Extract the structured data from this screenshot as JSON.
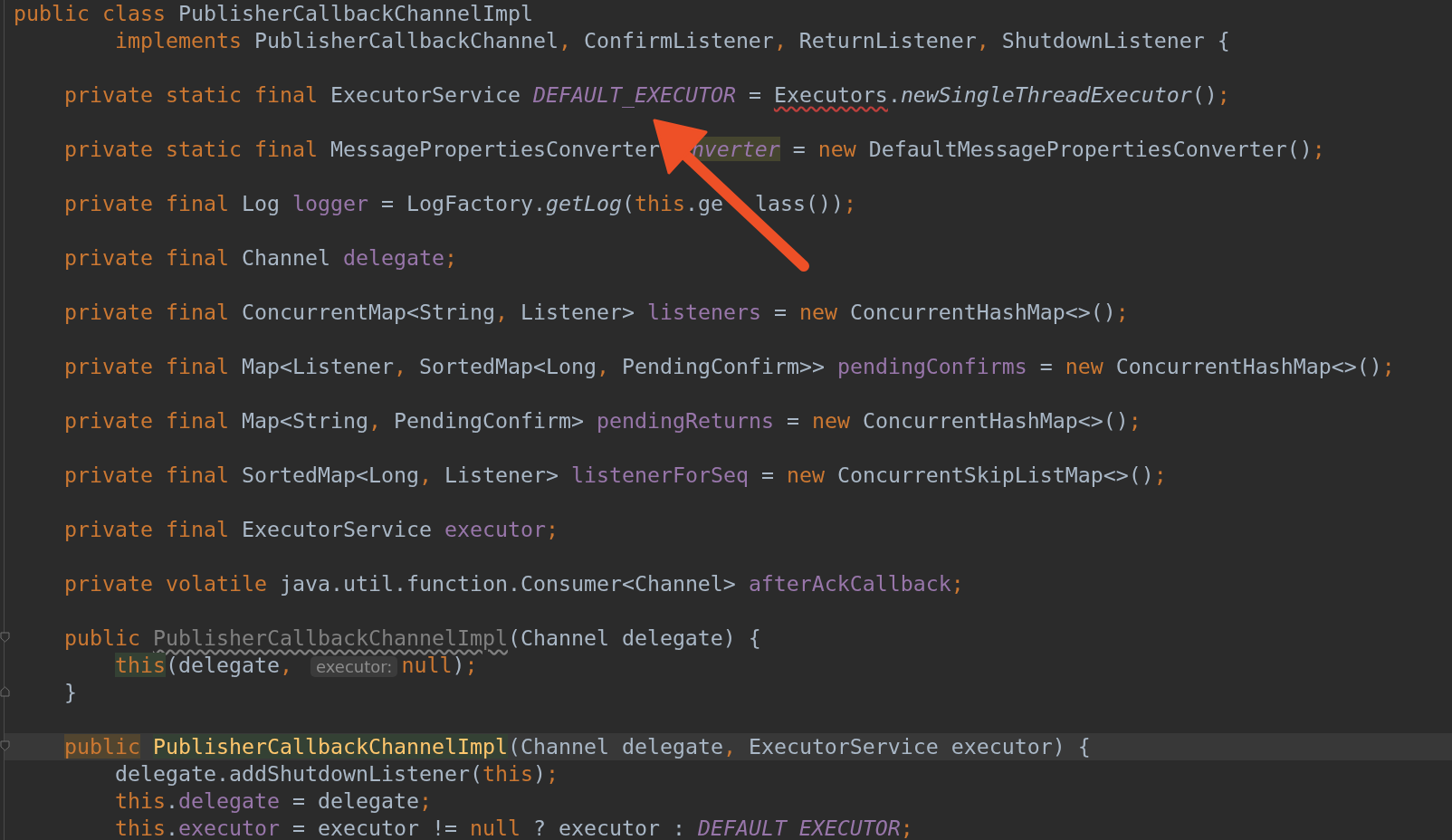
{
  "editor": {
    "lines": [
      {
        "kind": "top",
        "current": false,
        "tokens": [
          {
            "kind": "keyword",
            "text": "public class"
          },
          {
            "kind": "plain",
            "text": " PublisherCallbackChannelImpl"
          }
        ]
      },
      {
        "kind": "body",
        "current": false,
        "tokens": [
          {
            "kind": "keyword",
            "text": "implements"
          },
          {
            "kind": "plain",
            "text": " PublisherCallbackChannel"
          },
          {
            "kind": "keyword",
            "text": ","
          },
          {
            "kind": "plain",
            "text": " ConfirmListener"
          },
          {
            "kind": "keyword",
            "text": ","
          },
          {
            "kind": "plain",
            "text": " ReturnListener"
          },
          {
            "kind": "keyword",
            "text": ","
          },
          {
            "kind": "plain",
            "text": " ShutdownListener {"
          }
        ]
      },
      {
        "kind": "blank"
      },
      {
        "kind": "member",
        "current": false,
        "tokens": [
          {
            "kind": "keyword",
            "text": "private static final"
          },
          {
            "kind": "plain",
            "text": " ExecutorService "
          },
          {
            "kind": "static",
            "text": "DEFAULT_EXECUTOR"
          },
          {
            "kind": "plain",
            "text": " = "
          },
          {
            "kind": "warning",
            "text": "Executors"
          },
          {
            "kind": "plain",
            "text": "."
          },
          {
            "kind": "call",
            "text": "newSingleThreadExecutor"
          },
          {
            "kind": "plain",
            "text": "()"
          },
          {
            "kind": "keyword",
            "text": ";"
          }
        ]
      },
      {
        "kind": "blank"
      },
      {
        "kind": "member",
        "current": false,
        "tokens": [
          {
            "kind": "keyword",
            "text": "private static final"
          },
          {
            "kind": "plain",
            "text": " MessagePropertiesConverter"
          },
          {
            "kind": "covered"
          },
          {
            "kind": "static",
            "text": "nverter",
            "highlighted": true,
            "color": "#45452f"
          },
          {
            "kind": "plain",
            "text": " = "
          },
          {
            "kind": "keyword",
            "text": "new"
          },
          {
            "kind": "plain",
            "text": " DefaultMessagePropertiesConverter()"
          },
          {
            "kind": "keyword",
            "text": ";"
          }
        ]
      },
      {
        "kind": "blank"
      },
      {
        "kind": "member",
        "current": false,
        "tokens": [
          {
            "kind": "keyword",
            "text": "private final"
          },
          {
            "kind": "plain",
            "text": " Log "
          },
          {
            "kind": "field",
            "text": "logger"
          },
          {
            "kind": "plain",
            "text": " = LogFactory."
          },
          {
            "kind": "call",
            "text": "getLog"
          },
          {
            "kind": "plain",
            "text": "("
          },
          {
            "kind": "keyword",
            "text": "this"
          },
          {
            "kind": "plain",
            "text": ".ge"
          },
          {
            "kind": "covered"
          },
          {
            "kind": "plain",
            "text": "lass())"
          },
          {
            "kind": "keyword",
            "text": ";"
          }
        ]
      },
      {
        "kind": "blank"
      },
      {
        "kind": "member",
        "current": false,
        "tokens": [
          {
            "kind": "keyword",
            "text": "private final"
          },
          {
            "kind": "plain",
            "text": " Channel "
          },
          {
            "kind": "field",
            "text": "delegate"
          },
          {
            "kind": "keyword",
            "text": ";"
          }
        ]
      },
      {
        "kind": "blank"
      },
      {
        "kind": "member",
        "current": false,
        "tokens": [
          {
            "kind": "keyword",
            "text": "private final"
          },
          {
            "kind": "plain",
            "text": " ConcurrentMap<String"
          },
          {
            "kind": "keyword",
            "text": ","
          },
          {
            "kind": "plain",
            "text": " Listener> "
          },
          {
            "kind": "field",
            "text": "listeners"
          },
          {
            "kind": "plain",
            "text": " = "
          },
          {
            "kind": "keyword",
            "text": "new"
          },
          {
            "kind": "plain",
            "text": " ConcurrentHashMap<>()"
          },
          {
            "kind": "keyword",
            "text": ";"
          }
        ]
      },
      {
        "kind": "blank"
      },
      {
        "kind": "member",
        "current": false,
        "tokens": [
          {
            "kind": "keyword",
            "text": "private final"
          },
          {
            "kind": "plain",
            "text": " Map<Listener"
          },
          {
            "kind": "keyword",
            "text": ","
          },
          {
            "kind": "plain",
            "text": " SortedMap<Long"
          },
          {
            "kind": "keyword",
            "text": ","
          },
          {
            "kind": "plain",
            "text": " PendingConfirm>> "
          },
          {
            "kind": "field",
            "text": "pendingConfirms"
          },
          {
            "kind": "plain",
            "text": " = "
          },
          {
            "kind": "keyword",
            "text": "new"
          },
          {
            "kind": "plain",
            "text": " ConcurrentHashMap<>()"
          },
          {
            "kind": "keyword",
            "text": ";"
          }
        ]
      },
      {
        "kind": "blank"
      },
      {
        "kind": "member",
        "current": false,
        "tokens": [
          {
            "kind": "keyword",
            "text": "private final"
          },
          {
            "kind": "plain",
            "text": " Map<String"
          },
          {
            "kind": "keyword",
            "text": ","
          },
          {
            "kind": "plain",
            "text": " PendingConfirm> "
          },
          {
            "kind": "field",
            "text": "pendingReturns"
          },
          {
            "kind": "plain",
            "text": " = "
          },
          {
            "kind": "keyword",
            "text": "new"
          },
          {
            "kind": "plain",
            "text": " ConcurrentHashMap<>()"
          },
          {
            "kind": "keyword",
            "text": ";"
          }
        ]
      },
      {
        "kind": "blank"
      },
      {
        "kind": "member",
        "current": false,
        "tokens": [
          {
            "kind": "keyword",
            "text": "private final"
          },
          {
            "kind": "plain",
            "text": " SortedMap<Long"
          },
          {
            "kind": "keyword",
            "text": ","
          },
          {
            "kind": "plain",
            "text": " Listener> "
          },
          {
            "kind": "field",
            "text": "listenerForSeq"
          },
          {
            "kind": "plain",
            "text": " = "
          },
          {
            "kind": "keyword",
            "text": "new"
          },
          {
            "kind": "plain",
            "text": " ConcurrentSkipListMap<>()"
          },
          {
            "kind": "keyword",
            "text": ";"
          }
        ]
      },
      {
        "kind": "blank"
      },
      {
        "kind": "member",
        "current": false,
        "tokens": [
          {
            "kind": "keyword",
            "text": "private final"
          },
          {
            "kind": "plain",
            "text": " ExecutorService "
          },
          {
            "kind": "field",
            "text": "executor"
          },
          {
            "kind": "keyword",
            "text": ";"
          }
        ]
      },
      {
        "kind": "blank"
      },
      {
        "kind": "member",
        "current": false,
        "tokens": [
          {
            "kind": "keyword",
            "text": "private volatile"
          },
          {
            "kind": "plain",
            "text": " java.util.function.Consumer<Channel> "
          },
          {
            "kind": "field",
            "text": "afterAckCallback"
          },
          {
            "kind": "keyword",
            "text": ";"
          }
        ]
      },
      {
        "kind": "blank"
      },
      {
        "kind": "fold-open",
        "current": false,
        "tokens": [
          {
            "kind": "keyword",
            "text": "public "
          },
          {
            "kind": "unused",
            "text": "PublisherCallbackChannelImpl"
          },
          {
            "kind": "plain",
            "text": "(Channel delegate) {"
          }
        ]
      },
      {
        "kind": "body",
        "current": false,
        "tokens": [
          {
            "kind": "keyword",
            "text": "this",
            "highlighted": true,
            "color": "#344134"
          },
          {
            "kind": "plain",
            "text": "(delegate"
          },
          {
            "kind": "keyword",
            "text": ", "
          },
          {
            "kind": "hint",
            "text": "executor:"
          },
          {
            "kind": "keyword",
            "text": "null"
          },
          {
            "kind": "plain",
            "text": ")"
          },
          {
            "kind": "keyword",
            "text": ";"
          }
        ]
      },
      {
        "kind": "fold-close",
        "current": false,
        "tokens": [
          {
            "kind": "plain",
            "text": "}"
          }
        ]
      },
      {
        "kind": "blank"
      },
      {
        "kind": "fold-open",
        "current": true,
        "tokens": [
          {
            "kind": "keyword",
            "text": "public",
            "highlighted": true,
            "color": "#52452f"
          },
          {
            "kind": "method",
            "text": "PublisherCallbackChannelImpl",
            "highlighted": true,
            "color": "#344134"
          },
          {
            "kind": "plain",
            "text": "(Channel delegate"
          },
          {
            "kind": "keyword",
            "text": ","
          },
          {
            "kind": "plain",
            "text": " ExecutorService executor) {"
          }
        ]
      },
      {
        "kind": "body",
        "current": false,
        "tokens": [
          {
            "kind": "plain",
            "text": "delegate.addShutdownListener("
          },
          {
            "kind": "keyword",
            "text": "this"
          },
          {
            "kind": "plain",
            "text": ")"
          },
          {
            "kind": "keyword",
            "text": ";"
          }
        ]
      },
      {
        "kind": "body",
        "current": false,
        "tokens": [
          {
            "kind": "keyword",
            "text": "this"
          },
          {
            "kind": "plain",
            "text": "."
          },
          {
            "kind": "field",
            "text": "delegate"
          },
          {
            "kind": "plain",
            "text": " = delegate"
          },
          {
            "kind": "keyword",
            "text": ";"
          }
        ]
      },
      {
        "kind": "body",
        "current": false,
        "tokens": [
          {
            "kind": "keyword",
            "text": "this"
          },
          {
            "kind": "plain",
            "text": "."
          },
          {
            "kind": "field",
            "text": "executor"
          },
          {
            "kind": "plain",
            "text": " = executor != "
          },
          {
            "kind": "keyword",
            "text": "null"
          },
          {
            "kind": "plain",
            "text": " ? executor : "
          },
          {
            "kind": "static",
            "text": "DEFAULT_EXECUTOR"
          },
          {
            "kind": "keyword",
            "text": ";"
          }
        ]
      }
    ]
  },
  "overlay": {
    "kind": "arrow"
  }
}
